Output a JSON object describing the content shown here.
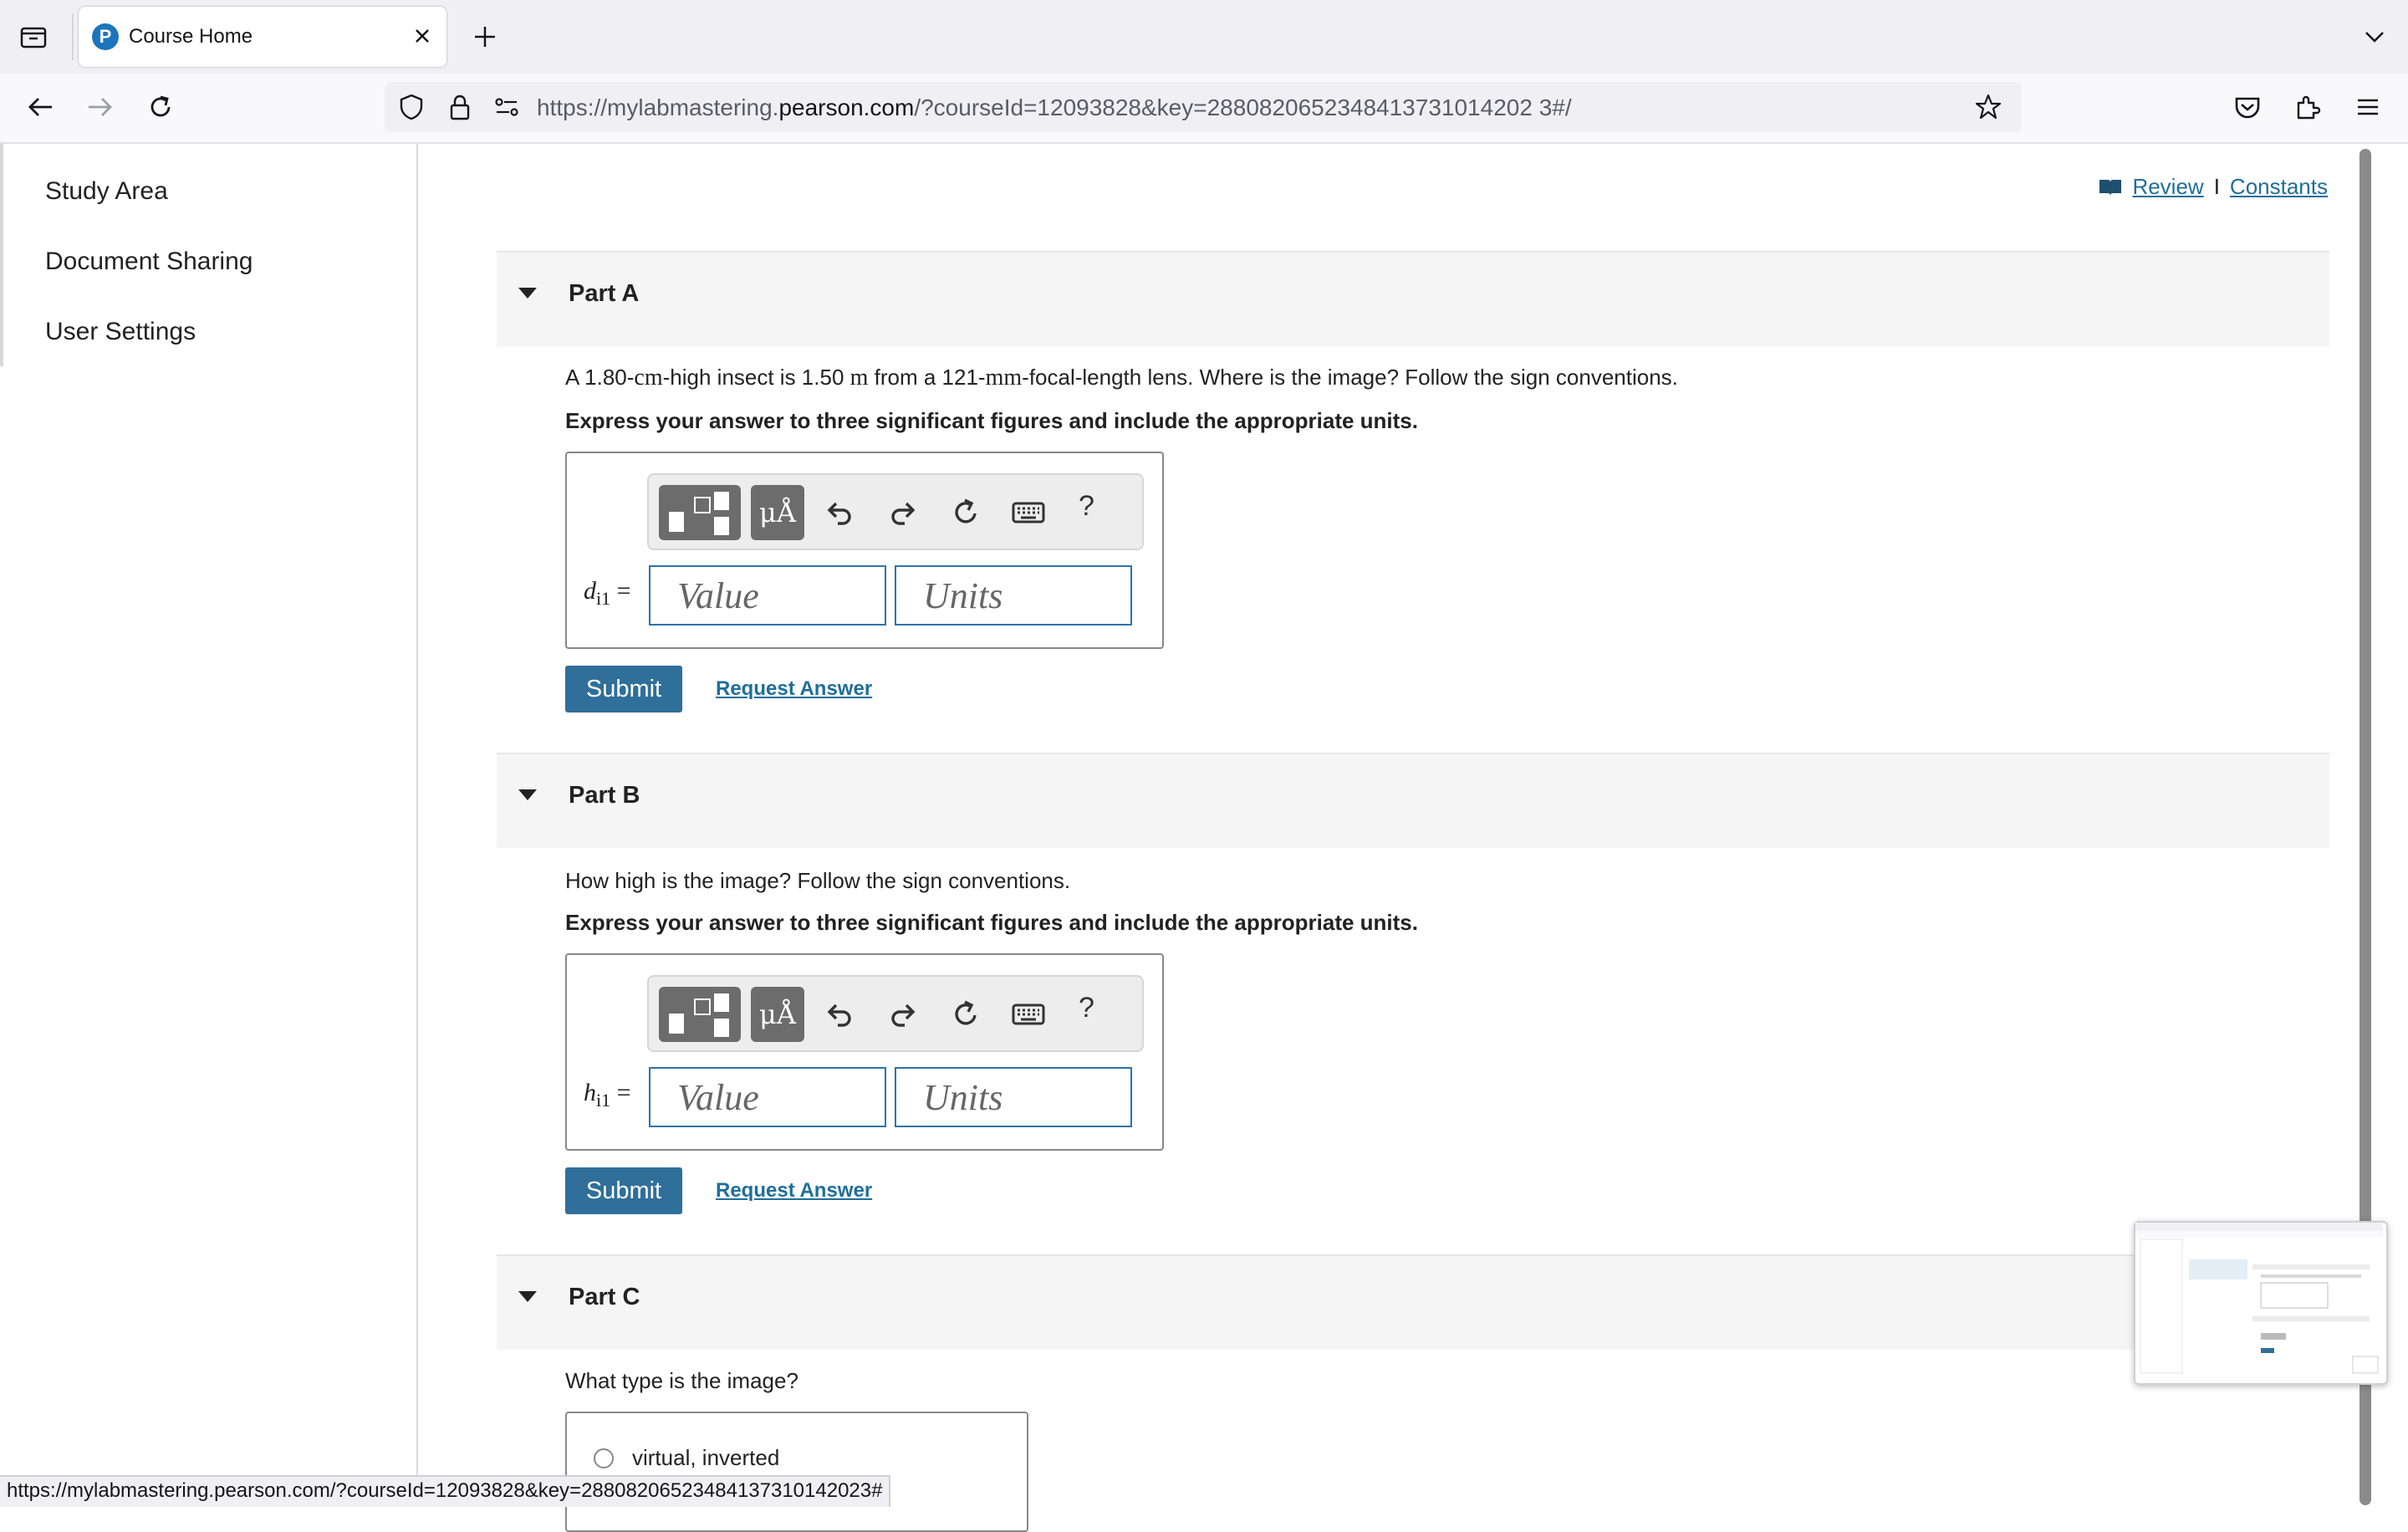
{
  "browser": {
    "tab_title": "Course Home",
    "url_prefix": "https://mylabmastering.",
    "url_host": "pearson.com",
    "url_suffix": "/?courseId=12093828&key=2880820652348413731014202 3#/",
    "status_url": "https://mylabmastering.pearson.com/?courseId=12093828&key=288082065234841373101420​23#"
  },
  "sidebar": {
    "items": [
      {
        "label": "Study Area"
      },
      {
        "label": "Document Sharing"
      },
      {
        "label": "User Settings"
      }
    ]
  },
  "top_links": {
    "review": "Review",
    "separator": "I",
    "constants": "Constants"
  },
  "toolbar": {
    "mu_label": "μÅ",
    "help": "?"
  },
  "parts": [
    {
      "title": "Part A",
      "question_pre": "A 1.80-",
      "q_u1": "cm",
      "question_mid1": "-high insect is 1.50 ",
      "q_u2": "m",
      "question_mid2": " from a 121-",
      "q_u3": "mm",
      "question_post": "-focal-length lens. Where is the image? Follow the sign conventions.",
      "instruction": "Express your answer to three significant figures and include the appropriate units.",
      "var_symbol": "d",
      "var_sub": "i1",
      "equals": "=",
      "value_placeholder": "Value",
      "units_placeholder": "Units",
      "submit": "Submit",
      "request": "Request Answer"
    },
    {
      "title": "Part B",
      "question": "How high is the image? Follow the sign conventions.",
      "instruction": "Express your answer to three significant figures and include the appropriate units.",
      "var_symbol": "h",
      "var_sub": "i1",
      "equals": "=",
      "value_placeholder": "Value",
      "units_placeholder": "Units",
      "submit": "Submit",
      "request": "Request Answer"
    },
    {
      "title": "Part C",
      "question": "What type is the image?",
      "options": [
        "virtual, inverted"
      ]
    }
  ]
}
